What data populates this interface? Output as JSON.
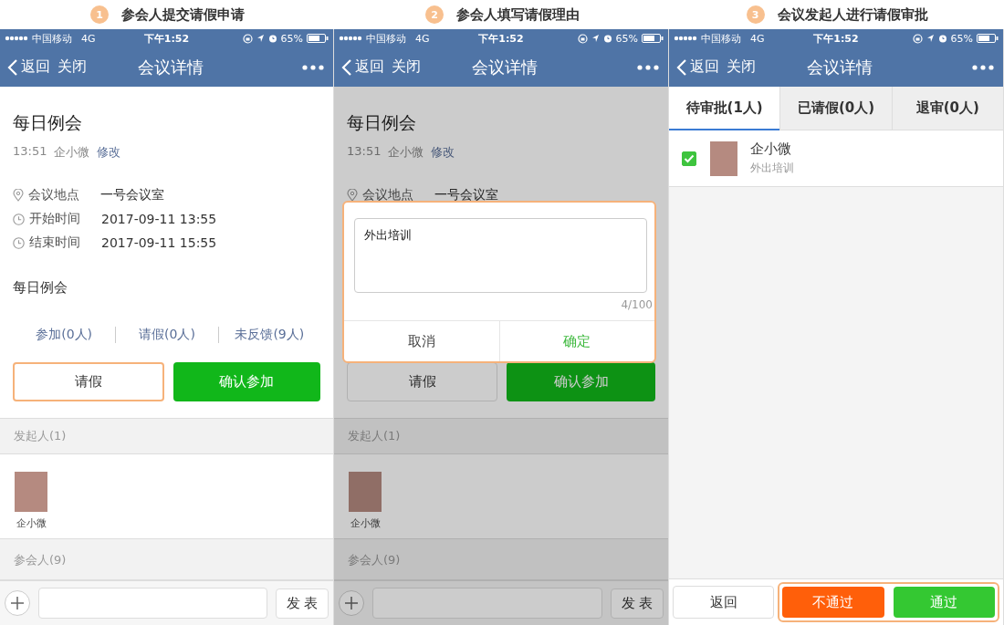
{
  "steps": [
    {
      "number": "1",
      "caption": "参会人提交请假申请"
    },
    {
      "number": "2",
      "caption": "参会人填写请假理由"
    },
    {
      "number": "3",
      "caption": "会议发起人进行请假审批"
    }
  ],
  "phones": [
    {
      "kind": "detail",
      "dimmed": false,
      "status_bar": {
        "carrier": "中国移动",
        "network": "4G",
        "time": "下午1:52",
        "battery": "65%"
      },
      "nav": {
        "back": "返回",
        "close": "关闭",
        "title": "会议详情"
      },
      "meeting": {
        "title": "每日例会",
        "time": "13:51",
        "organizer": "企小微",
        "edit": "修改",
        "details": [
          {
            "kind": "location",
            "label": "会议地点",
            "value": "一号会议室"
          },
          {
            "kind": "time",
            "label": "开始时间",
            "value": "2017-09-11 13:55"
          },
          {
            "kind": "time",
            "label": "结束时间",
            "value": "2017-09-11 15:55"
          }
        ],
        "description": "每日例会",
        "counts": [
          "参加(0人)",
          "请假(0人)",
          "未反馈(9人)"
        ]
      },
      "actions": {
        "leave": "请假",
        "confirm": "确认参加",
        "leave_highlighted": true
      },
      "organizer_section": {
        "header": "发起人(1)",
        "people": [
          {
            "name": "企小微"
          }
        ]
      },
      "participants_header": "参会人(9)",
      "composer": {
        "send": "发 表"
      }
    },
    {
      "kind": "detail",
      "dimmed": true,
      "status_bar": {
        "carrier": "中国移动",
        "network": "4G",
        "time": "下午1:52",
        "battery": "65%"
      },
      "nav": {
        "back": "返回",
        "close": "关闭",
        "title": "会议详情"
      },
      "meeting": {
        "title": "每日例会",
        "time": "13:51",
        "organizer": "企小微",
        "edit": "修改",
        "details": [
          {
            "kind": "location",
            "label": "会议地点",
            "value": "一号会议室"
          }
        ]
      },
      "dialog": {
        "text": "外出培训",
        "counter": "4/100",
        "cancel": "取消",
        "ok": "确定",
        "highlighted": true
      },
      "actions": {
        "leave": "请假",
        "confirm": "确认参加",
        "leave_highlighted": false
      },
      "organizer_section": {
        "header": "发起人(1)",
        "people": [
          {
            "name": "企小微"
          }
        ]
      },
      "participants_header": "参会人(9)",
      "composer": {
        "send": "发 表"
      }
    },
    {
      "kind": "approval",
      "status_bar": {
        "carrier": "中国移动",
        "network": "4G",
        "time": "下午1:52",
        "battery": "65%"
      },
      "nav": {
        "back": "返回",
        "close": "关闭",
        "title": "会议详情"
      },
      "tabs": [
        {
          "label": "待审批(1人)",
          "selected": true
        },
        {
          "label": "已请假(0人)",
          "selected": false
        },
        {
          "label": "退审(0人)",
          "selected": false
        }
      ],
      "requests": [
        {
          "name": "企小微",
          "reason": "外出培训",
          "checked": true
        }
      ],
      "footer": {
        "back": "返回",
        "reject": "不通过",
        "approve": "通过",
        "decision_highlighted": true
      }
    }
  ]
}
